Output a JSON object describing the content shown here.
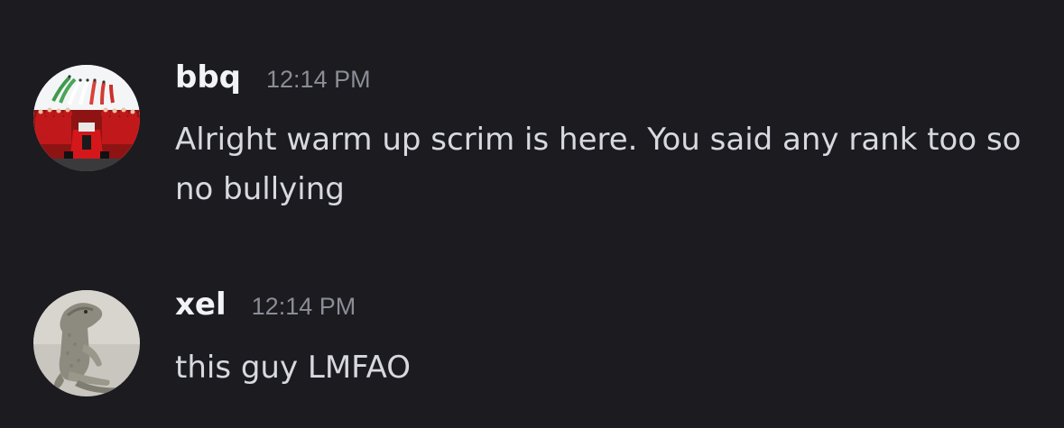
{
  "messages": [
    {
      "avatar_icon": "ferrari-f1-team-photo-avatar",
      "username": "bbq",
      "timestamp": "12:14 PM",
      "text": "Alright warm up scrim is here. You said any rank too so no bullying"
    },
    {
      "avatar_icon": "lizard-figurine-avatar",
      "username": "xel",
      "timestamp": "12:14 PM",
      "text": "this guy LMFAO"
    }
  ],
  "colors": {
    "background": "#1b1b20",
    "username": "#f2f3f5",
    "timestamp": "#8b8d96",
    "message_text": "#d7d9de"
  }
}
